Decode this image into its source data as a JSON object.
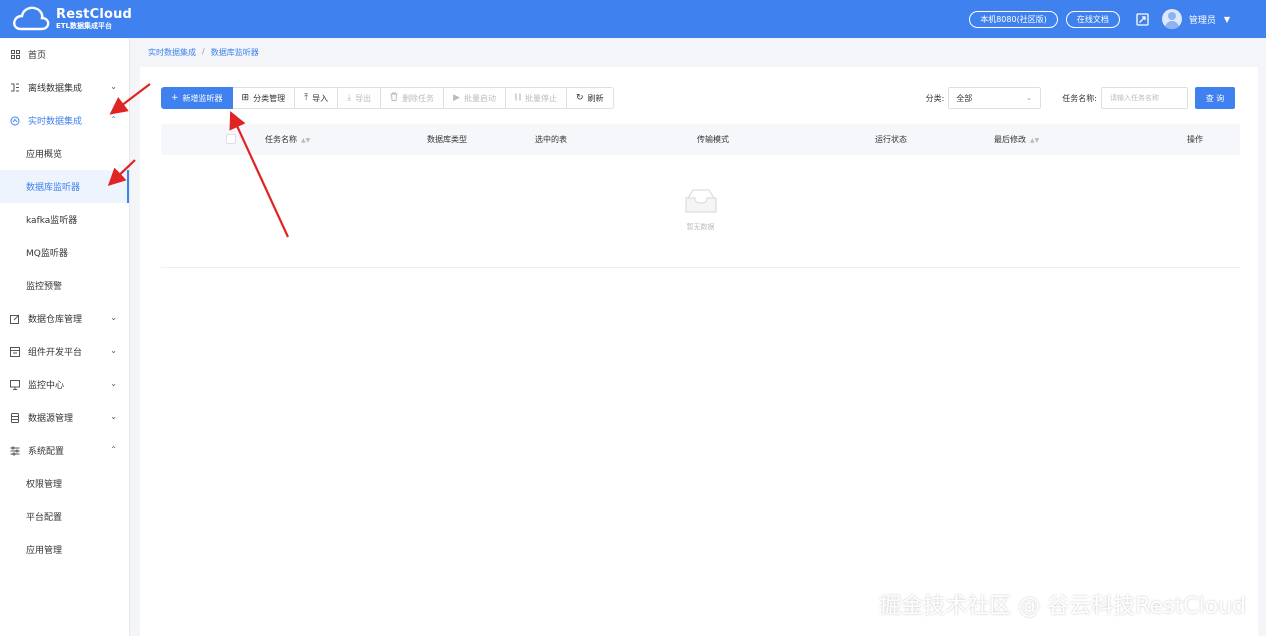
{
  "header": {
    "logo_title": "RestCloud",
    "logo_subtitle": "ETL数据集成平台",
    "env_pill": "本机8080(社区版)",
    "docs_pill": "在线文档",
    "user_name": "管理员",
    "accent": "#3e81ef"
  },
  "sidebar": {
    "items": [
      {
        "label": "首页",
        "icon": "grid-icon"
      },
      {
        "label": "离线数据集成",
        "icon": "offline-icon",
        "chevron": "⌄"
      },
      {
        "label": "实时数据集成",
        "icon": "realtime-icon",
        "chevron": "⌃"
      }
    ],
    "realtime_sub": [
      "应用概览",
      "数据库监听器",
      "kafka监听器",
      "MQ监听器",
      "监控预警"
    ],
    "groups": [
      {
        "label": "数据仓库管理",
        "icon": "edit-icon",
        "chevron": "⌄"
      },
      {
        "label": "组件开发平台",
        "icon": "component-icon",
        "chevron": "⌄"
      },
      {
        "label": "监控中心",
        "icon": "monitor-icon",
        "chevron": "⌄"
      },
      {
        "label": "数据源管理",
        "icon": "database-icon",
        "chevron": "⌄"
      },
      {
        "label": "系统配置",
        "icon": "settings-icon",
        "chevron": "⌃"
      }
    ],
    "system_sub": [
      "权限管理",
      "平台配置",
      "应用管理"
    ]
  },
  "breadcrumb": {
    "parent": "实时数据集成",
    "separator": "/",
    "current": "数据库监听器"
  },
  "toolbar": {
    "buttons": [
      {
        "label": "新增监听器",
        "icon": "+"
      },
      {
        "label": "分类管理",
        "icon": "⊞"
      },
      {
        "label": "导入",
        "icon": "⤒"
      },
      {
        "label": "导出",
        "icon": "⤓"
      },
      {
        "label": "删除任务",
        "icon": "🗑"
      },
      {
        "label": "批量启动",
        "icon": "▶"
      },
      {
        "label": "批量停止",
        "icon": "⏸"
      },
      {
        "label": "刷新",
        "icon": "↻"
      }
    ]
  },
  "filters": {
    "category_label": "分类:",
    "category_value": "全部",
    "task_label": "任务名称:",
    "task_placeholder": "请输入任务名称",
    "query_label": "查 询"
  },
  "table": {
    "columns": [
      "任务名称",
      "数据库类型",
      "选中的表",
      "传输模式",
      "运行状态",
      "最后修改",
      "操作"
    ],
    "empty_text": "暂无数据"
  },
  "watermark": "掘金技术社区 @ 谷云科技RestCloud"
}
